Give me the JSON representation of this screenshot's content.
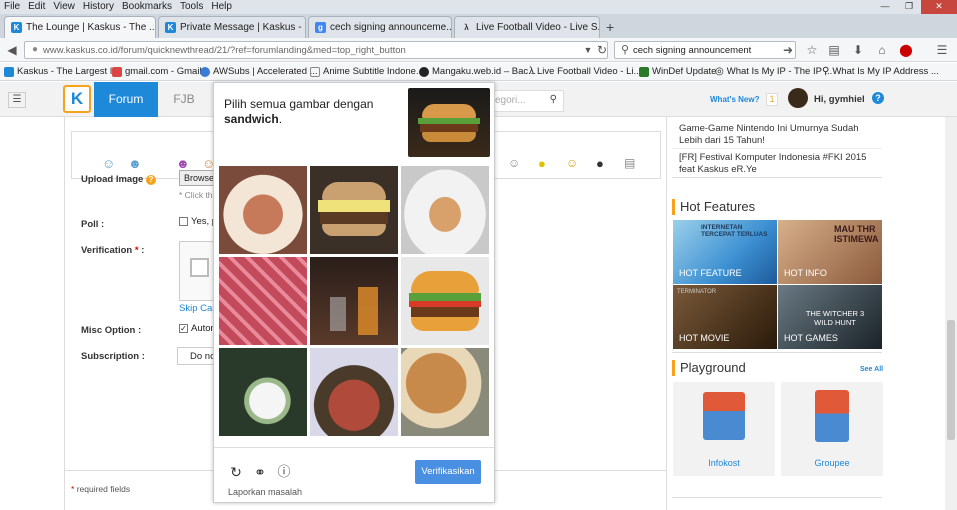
{
  "menu": [
    "File",
    "Edit",
    "View",
    "History",
    "Bookmarks",
    "Tools",
    "Help"
  ],
  "tabs": [
    {
      "title": "The Lounge | Kaskus - The ...",
      "favicon": "K",
      "color": "#1e88d9"
    },
    {
      "title": "Private Message | Kaskus - ...",
      "favicon": "K",
      "color": "#1e88d9"
    },
    {
      "title": "cech signing announceme...",
      "favicon": "g",
      "color": "#4285f4"
    },
    {
      "title": "Live Football Video - Live S...",
      "favicon": "⚽",
      "color": "#333"
    }
  ],
  "new_tab": "+",
  "address": {
    "url": "www.kaskus.co.id/forum/quicknewthread/21/?ref=forumlanding&med=top_right_button",
    "search": "cech signing announcement"
  },
  "bookmarks": [
    "Kaskus - The Largest I...",
    "gmail.com - Gmail",
    "AWSubs | Accelerated ...",
    "Anime Subtitle Indone...",
    "Mangaku.web.id – Bac...",
    "Live Football Video - Li...",
    "WinDef Update",
    "What Is My IP - The IP ...",
    "What Is My IP Address ..."
  ],
  "kaskus": {
    "logo": "K",
    "forum": "Forum",
    "fjb": "FJB",
    "search_placeholder": "egori...",
    "whats_new": "What's New?",
    "notif": "1",
    "user": "Hi, gymhiel",
    "help": "?"
  },
  "form": {
    "upload_label": "Upload Image",
    "browse": "Browse",
    "click_hint": "* Click th",
    "poll_label": "Poll :",
    "poll_opt": "Yes, p",
    "verification_label": "Verification",
    "required_star": "*",
    "skip": "Skip Cap",
    "misc_label": "Misc Option :",
    "misc_opt": "Autom",
    "sub_label": "Subscription :",
    "sub_opt": "Do no",
    "required": "required fields"
  },
  "sidebar": {
    "links": [
      "Game-Game Nintendo Ini Umurnya Sudah Lebih dari 15 Tahun!",
      "[FR] Festival Komputer Indonesia #FKI 2015 feat Kaskus eR.Ye"
    ],
    "hot_title": "Hot Features",
    "tiles": [
      {
        "label": "HOT FEATURE",
        "art": "INTERNETAN TERCEPAT TERLUAS",
        "color": "#3b8fd1"
      },
      {
        "label": "HOT INFO",
        "art": "MAU THR ISTIMEWA",
        "color": "#8b5a3c"
      },
      {
        "label": "HOT MOVIE",
        "art": "TERMINATOR",
        "color": "#3a2a1a"
      },
      {
        "label": "HOT GAMES",
        "art": "THE WITCHER 3 WILD HUNT",
        "color": "#2f3a44"
      }
    ],
    "playground_title": "Playground",
    "see_all": "See All",
    "playground": [
      "Infokost",
      "Groupee"
    ]
  },
  "captcha": {
    "prompt": "Pilih semua gambar dengan",
    "target": "sandwich",
    "verify": "Verifikasikan",
    "report": "Laporkan masalah",
    "cells": [
      {
        "name": "food",
        "bg": "#a65a3a"
      },
      {
        "name": "burger",
        "bg": "#4c3e2a"
      },
      {
        "name": "shrimp",
        "bg": "#c99a6a"
      },
      {
        "name": "meat",
        "bg": "#b24a5a"
      },
      {
        "name": "drinks",
        "bg": "#3a2a24"
      },
      {
        "name": "burger-toy",
        "bg": "#c98a3a"
      },
      {
        "name": "dessert",
        "bg": "#2a3a2a"
      },
      {
        "name": "birthday-cake",
        "bg": "#2a2a3a"
      },
      {
        "name": "fried-food",
        "bg": "#b88a4a"
      }
    ]
  }
}
